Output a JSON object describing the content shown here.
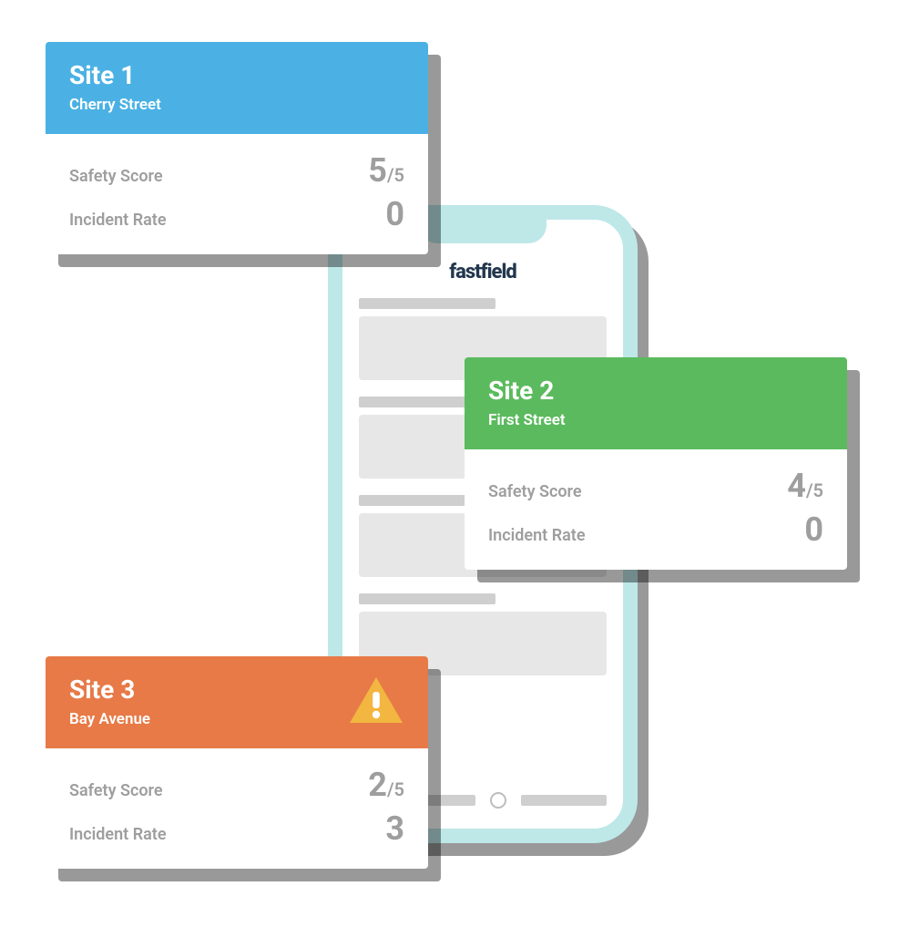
{
  "phone": {
    "brand": "fastfield"
  },
  "cards": [
    {
      "title": "Site 1",
      "subtitle": "Cherry Street",
      "header_color": "blue",
      "warning": false,
      "metrics": [
        {
          "label": "Safety Score",
          "value": "5",
          "suffix": "/5"
        },
        {
          "label": "Incident Rate",
          "value": "0",
          "suffix": ""
        }
      ]
    },
    {
      "title": "Site 2",
      "subtitle": "First Street",
      "header_color": "green",
      "warning": false,
      "metrics": [
        {
          "label": "Safety Score",
          "value": "4",
          "suffix": "/5"
        },
        {
          "label": "Incident Rate",
          "value": "0",
          "suffix": ""
        }
      ]
    },
    {
      "title": "Site 3",
      "subtitle": "Bay Avenue",
      "header_color": "orange",
      "warning": true,
      "metrics": [
        {
          "label": "Safety Score",
          "value": "2",
          "suffix": "/5"
        },
        {
          "label": "Incident Rate",
          "value": "3",
          "suffix": ""
        }
      ]
    }
  ]
}
